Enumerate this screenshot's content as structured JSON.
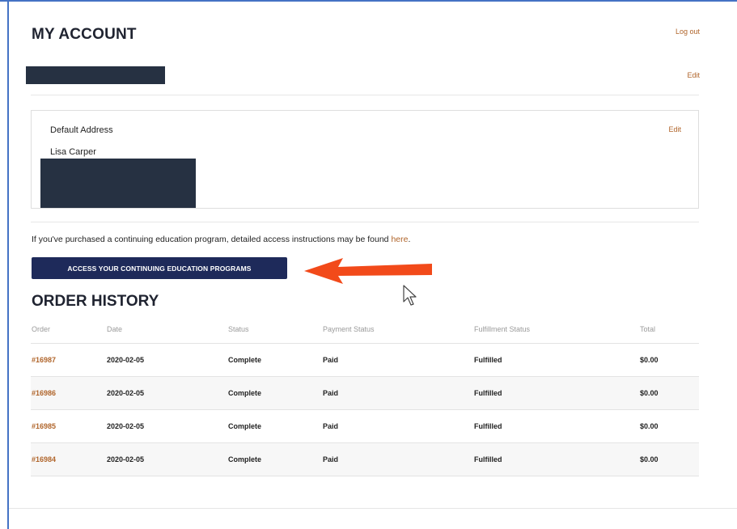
{
  "header": {
    "title": "MY ACCOUNT",
    "logout_label": "Log out",
    "edit_label": "Edit"
  },
  "address": {
    "label": "Default Address",
    "edit_label": "Edit",
    "name": "Lisa Carper"
  },
  "continuing_ed": {
    "note_text": "If you've purchased a continuing education program, detailed access instructions may be found ",
    "link_text": "here",
    "note_end": ".",
    "button_label": "ACCESS YOUR CONTINUING EDUCATION PROGRAMS"
  },
  "order_history": {
    "title": "ORDER HISTORY",
    "columns": [
      "Order",
      "Date",
      "Status",
      "Payment Status",
      "Fulfillment Status",
      "Total"
    ],
    "rows": [
      {
        "order": "#16987",
        "date": "2020-02-05",
        "status": "Complete",
        "payment": "Paid",
        "fulfillment": "Fulfilled",
        "total": "$0.00"
      },
      {
        "order": "#16986",
        "date": "2020-02-05",
        "status": "Complete",
        "payment": "Paid",
        "fulfillment": "Fulfilled",
        "total": "$0.00"
      },
      {
        "order": "#16985",
        "date": "2020-02-05",
        "status": "Complete",
        "payment": "Paid",
        "fulfillment": "Fulfilled",
        "total": "$0.00"
      },
      {
        "order": "#16984",
        "date": "2020-02-05",
        "status": "Complete",
        "payment": "Paid",
        "fulfillment": "Fulfilled",
        "total": "$0.00"
      }
    ]
  },
  "colors": {
    "accent_link": "#b0652b",
    "button_bg": "#1e2a5a",
    "arrow": "#f24a1a",
    "redaction": "#263142"
  },
  "icons": {
    "arrow": "left-arrow-icon",
    "cursor": "mouse-cursor-icon"
  }
}
